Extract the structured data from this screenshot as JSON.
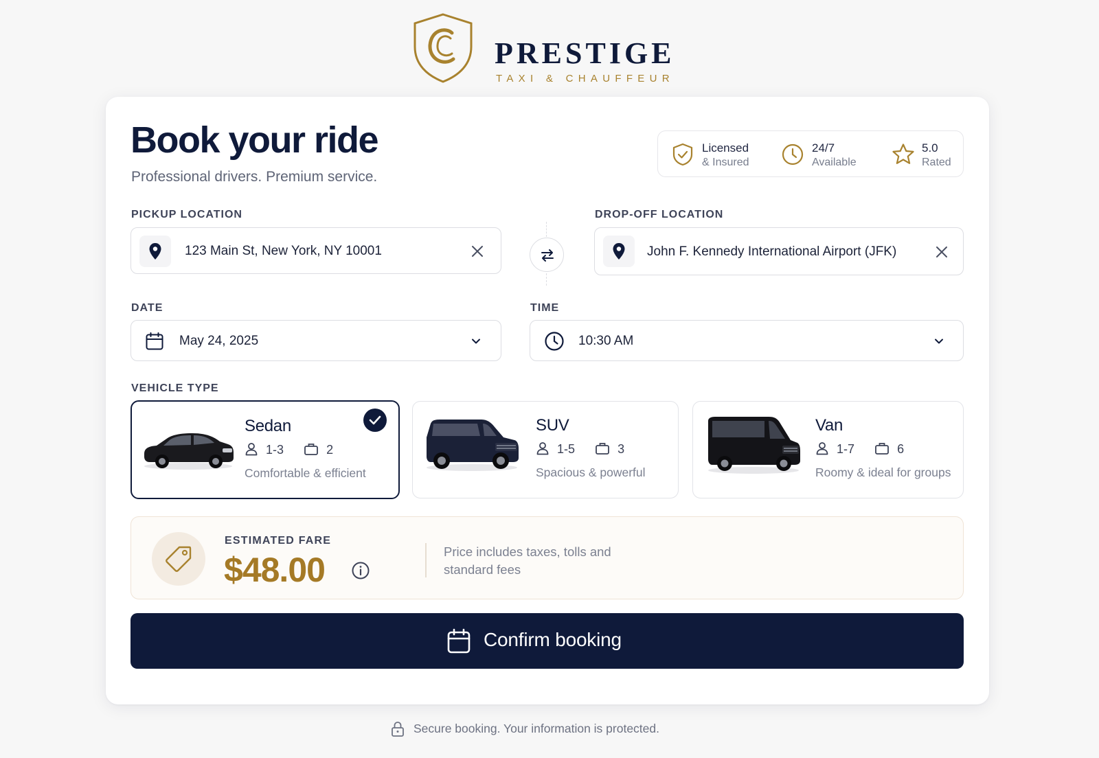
{
  "brand": {
    "name": "PRESTIGE",
    "tagline": "TAXI & CHAUFFEUR",
    "logo_letter": "C",
    "colors": {
      "navy": "#0f1a3a",
      "gold": "#a8822e"
    }
  },
  "header": {
    "title": "Book your ride",
    "subtitle": "Professional drivers. Premium service."
  },
  "badges": [
    {
      "icon": "shield-check-icon",
      "line1": "Licensed",
      "line2": "& Insured"
    },
    {
      "icon": "clock-icon",
      "line1": "24/7",
      "line2": "Available"
    },
    {
      "icon": "star-icon",
      "line1": "5.0",
      "line2": "Rated"
    }
  ],
  "pickup": {
    "label": "PICKUP LOCATION",
    "value": "123 Main St, New York, NY 10001",
    "icon": "map-pin-icon"
  },
  "dropoff": {
    "label": "DROP-OFF LOCATION",
    "value": "John F. Kennedy International Airport (JFK)",
    "icon": "map-pin-icon"
  },
  "date": {
    "label": "DATE",
    "value": "May 24, 2025",
    "icon": "calendar-icon"
  },
  "time": {
    "label": "TIME",
    "value": "10:30 AM",
    "icon": "clock-icon"
  },
  "vehicles": {
    "label": "VEHICLE TYPE",
    "selected": "Sedan",
    "items": [
      {
        "name": "Sedan",
        "passengers": "1-3",
        "bags": "2",
        "desc": "Comfortable & efficient"
      },
      {
        "name": "SUV",
        "passengers": "1-5",
        "bags": "3",
        "desc": "Spacious & powerful"
      },
      {
        "name": "Van",
        "passengers": "1-7",
        "bags": "6",
        "desc": "Roomy & ideal for groups"
      }
    ]
  },
  "fare": {
    "label": "ESTIMATED FARE",
    "amount": "$48.00",
    "note": "Price includes taxes, tolls and standard fees"
  },
  "confirm": {
    "label": "Confirm booking"
  },
  "footer": {
    "text": "Secure booking. Your information is protected."
  }
}
